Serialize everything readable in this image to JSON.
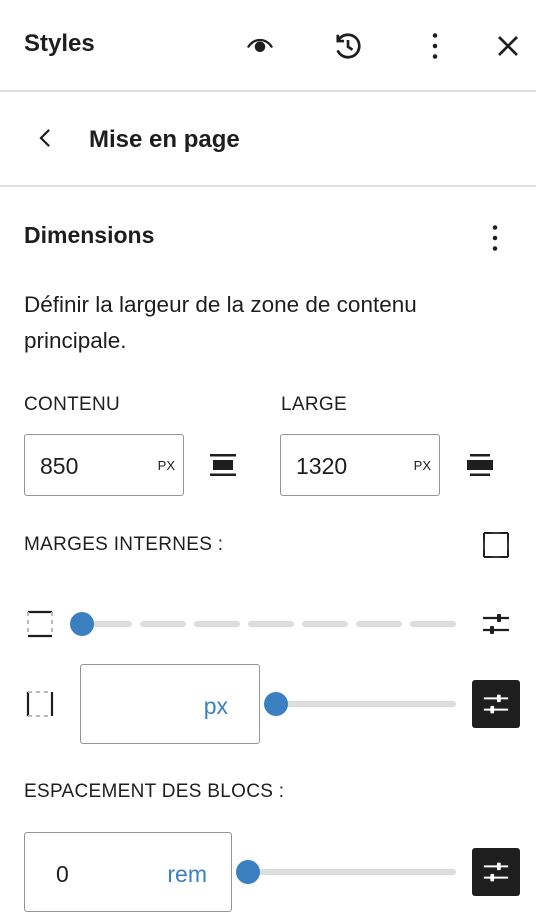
{
  "header": {
    "title": "Styles",
    "icons": [
      "eye-icon",
      "history-icon",
      "more-vertical-icon",
      "close-icon"
    ]
  },
  "nav": {
    "back_icon": "chevron-left-icon",
    "title": "Mise en page"
  },
  "dimensions": {
    "title": "Dimensions",
    "menu_icon": "more-vertical-icon",
    "description": "Définir la largeur de la zone de contenu principale.",
    "content": {
      "label": "CONTENU",
      "value": "850",
      "unit": "PX",
      "icon": "align-none-icon"
    },
    "wide": {
      "label": "LARGE",
      "value": "1320",
      "unit": "PX",
      "icon": "stretch-wide-icon"
    }
  },
  "padding": {
    "label": "MARGES INTERNES :",
    "sides_icon": "sides-all-icon",
    "vertical": {
      "icon": "sides-vertical-icon",
      "slider_position": 0,
      "steps": 8,
      "custom_icon": "settings-sliders-icon"
    },
    "horizontal": {
      "icon": "sides-horizontal-icon",
      "value": "",
      "unit": "px",
      "slider_position": 0,
      "custom_icon": "settings-sliders-icon"
    }
  },
  "block_spacing": {
    "label": "ESPACEMENT DES BLOCS :",
    "value": "0",
    "unit": "rem",
    "slider_position": 0,
    "custom_icon": "settings-sliders-icon"
  }
}
